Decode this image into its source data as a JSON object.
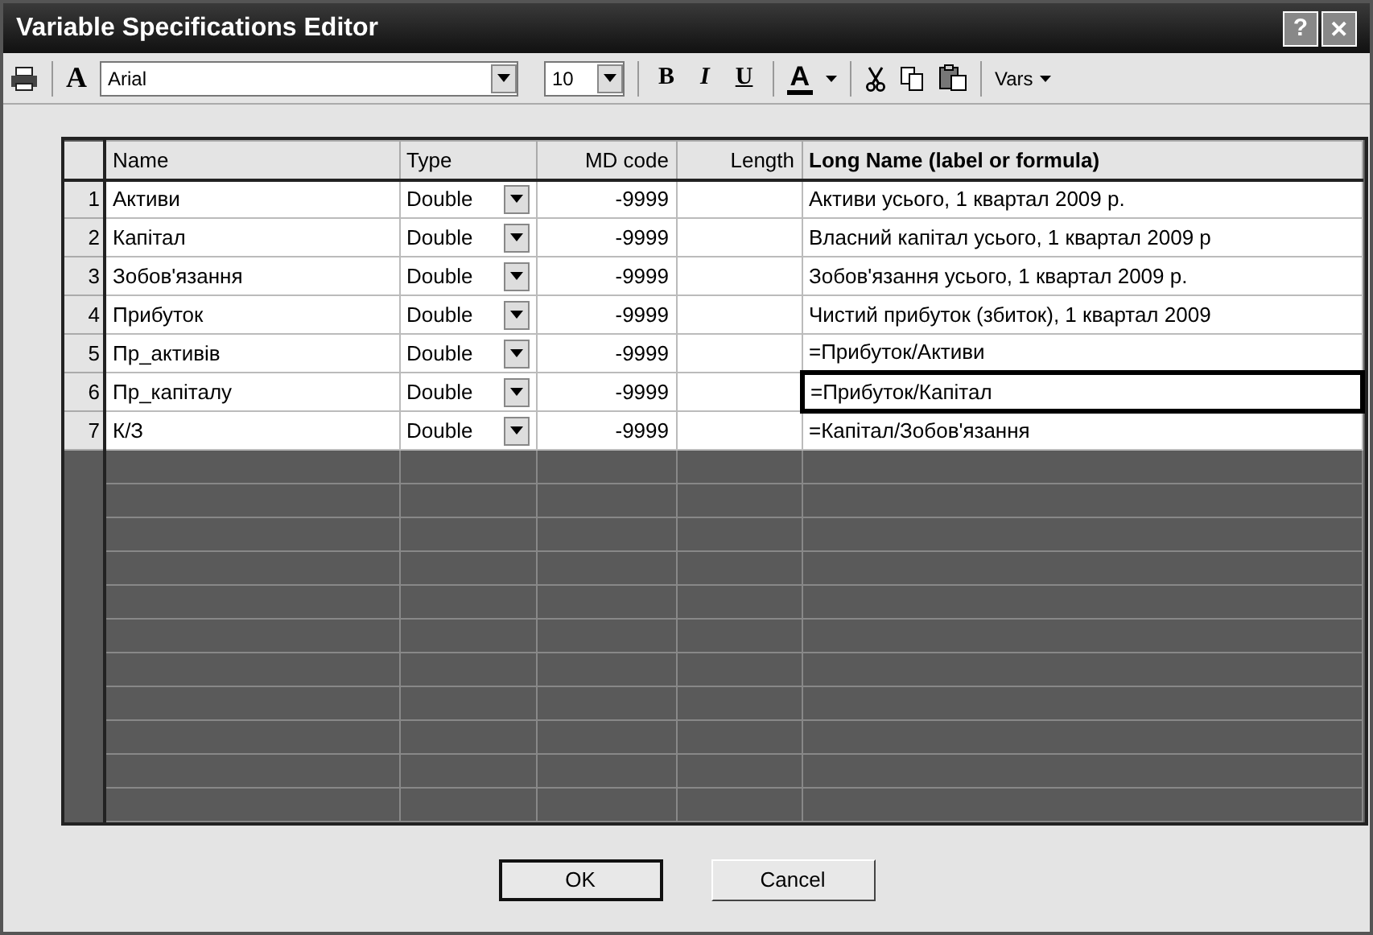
{
  "window": {
    "title": "Variable Specifications Editor",
    "help": "?",
    "close": "✕"
  },
  "toolbar": {
    "font_icon": "A",
    "font": "Arial",
    "size": "10",
    "bold": "B",
    "italic": "I",
    "underline": "U",
    "font_color": "A",
    "vars": "Vars"
  },
  "table": {
    "columns": [
      "Name",
      "Type",
      "MD code",
      "Length",
      "Long Name (label or formula)"
    ],
    "rows": [
      {
        "number": "1",
        "name": "Активи",
        "type": "Double",
        "md_code": "-9999",
        "long_name": "Активи усього, 1 квартал 2009 р.",
        "selected": false
      },
      {
        "number": "2",
        "name": "Капітал",
        "type": "Double",
        "md_code": "-9999",
        "long_name": "Власний капітал усього, 1 квартал 2009 р",
        "selected": false
      },
      {
        "number": "3",
        "name": "Зобов'язання",
        "type": "Double",
        "md_code": "-9999",
        "long_name": "Зобов'язання усього, 1 квартал 2009 р.",
        "selected": false
      },
      {
        "number": "4",
        "name": "Прибуток",
        "type": "Double",
        "md_code": "-9999",
        "long_name": "Чистий прибуток (збиток), 1 квартал 2009",
        "selected": false
      },
      {
        "number": "5",
        "name": "Пр_активів",
        "type": "Double",
        "md_code": "-9999",
        "long_name": "=Прибуток/Активи",
        "selected": false
      },
      {
        "number": "6",
        "name": "Пр_капіталу",
        "type": "Double",
        "md_code": "-9999",
        "long_name": "=Прибуток/Капітал",
        "selected": true
      },
      {
        "number": "7",
        "name": "К/З",
        "type": "Double",
        "md_code": "-9999",
        "long_name": "=Капітал/Зобов'язання",
        "selected": false
      }
    ]
  },
  "buttons": [
    {
      "label": "OK",
      "default": true
    },
    {
      "label": "Cancel",
      "default": false
    }
  ]
}
